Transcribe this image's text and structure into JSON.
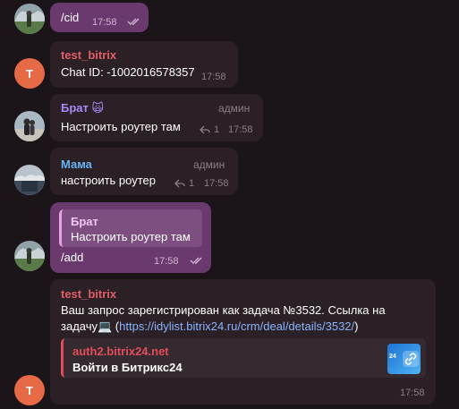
{
  "messages": [
    {
      "id": "m1",
      "type": "outgoing",
      "text": "/cid",
      "time": "17:58"
    },
    {
      "id": "m2",
      "type": "incoming",
      "avatar_letter": "T",
      "sender": "test_bitrix",
      "sender_color": "#e35d6a",
      "text": "Chat ID: -1002016578357",
      "time": "17:58"
    },
    {
      "id": "m3",
      "type": "incoming",
      "sender": "Брат",
      "sender_emoji": "🙀",
      "sender_color": "#a98af5",
      "role": "админ",
      "text": "Настроить роутер там",
      "reply_count": "1",
      "time": "17:58"
    },
    {
      "id": "m4",
      "type": "incoming",
      "sender": "Мама",
      "sender_color": "#6ab3f3",
      "role": "админ",
      "text": "настроить роутер",
      "reply_count": "1",
      "time": "17:58"
    },
    {
      "id": "m5",
      "type": "outgoing",
      "quote_sender": "Брат",
      "quote_text": "Настроить роутер там",
      "text": "/add",
      "time": "17:58"
    },
    {
      "id": "m6",
      "type": "incoming",
      "avatar_letter": "T",
      "sender": "test_bitrix",
      "sender_color": "#e35d6a",
      "line1": "Ваш запрос зарегистрирован как задача №3532. Ссылка на",
      "line2_prefix": "задачу",
      "line2_emoji": "💻",
      "line2_open": " (",
      "link": "https://idylist.bitrix24.ru/crm/deal/details/3532/",
      "line2_close": ")",
      "preview_site": "auth2.bitrix24.net",
      "preview_title": "Войти в Битрикс24",
      "preview_thumb_text": "24",
      "time": "17:58"
    }
  ],
  "colors": {
    "background": "#1b1418",
    "incoming_bubble": "#2a2025",
    "outgoing_bubble": "#6a3a6e",
    "link": "#8ab4ff"
  }
}
